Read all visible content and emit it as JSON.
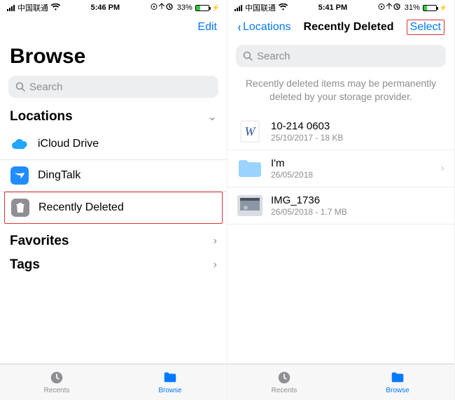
{
  "left": {
    "status": {
      "carrier": "中国联通",
      "time": "5:46 PM",
      "battery_pct": "33%",
      "battery_fill": 33
    },
    "nav": {
      "edit": "Edit"
    },
    "title": "Browse",
    "search_placeholder": "Search",
    "sections": {
      "locations": {
        "header": "Locations",
        "items": [
          {
            "id": "icloud",
            "label": "iCloud Drive"
          },
          {
            "id": "dingtalk",
            "label": "DingTalk"
          },
          {
            "id": "recently-deleted",
            "label": "Recently Deleted"
          }
        ]
      },
      "favorites": {
        "header": "Favorites"
      },
      "tags": {
        "header": "Tags"
      }
    },
    "tabs": {
      "recents": "Recents",
      "browse": "Browse"
    }
  },
  "right": {
    "status": {
      "carrier": "中国联通",
      "time": "5:41 PM",
      "battery_pct": "31%",
      "battery_fill": 31
    },
    "nav": {
      "back": "Locations",
      "title": "Recently Deleted",
      "select": "Select"
    },
    "search_placeholder": "Search",
    "info": "Recently deleted items may be permanently deleted by your storage provider.",
    "files": [
      {
        "id": "word-doc",
        "name": "10-214  0603",
        "sub": "25/10/2017 - 18 KB",
        "thumb": "word"
      },
      {
        "id": "folder-im",
        "name": "I'm",
        "sub": "26/05/2018",
        "thumb": "folder",
        "disclose": true
      },
      {
        "id": "img-1736",
        "name": "IMG_1736",
        "sub": "26/05/2018 - 1.7 MB",
        "thumb": "photo"
      }
    ],
    "tabs": {
      "recents": "Recents",
      "browse": "Browse"
    }
  }
}
